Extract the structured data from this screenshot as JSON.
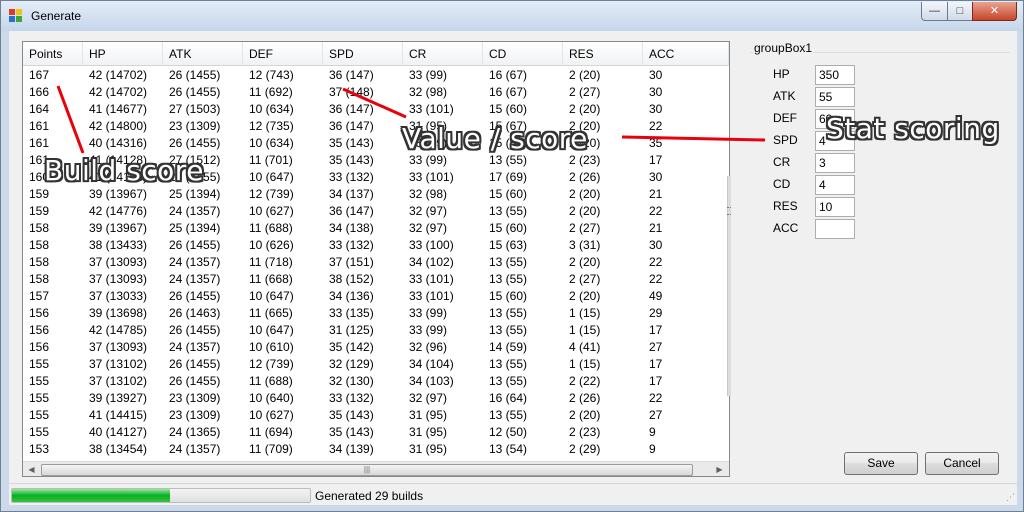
{
  "window": {
    "title": "Generate",
    "buttons": {
      "minimize": "—",
      "maximize": "□",
      "close": "✕"
    }
  },
  "table": {
    "columns": [
      "Points",
      "HP",
      "ATK",
      "DEF",
      "SPD",
      "CR",
      "CD",
      "RES",
      "ACC"
    ],
    "rows": [
      [
        "167",
        "42 (14702)",
        "26 (1455)",
        "12 (743)",
        "36 (147)",
        "33 (99)",
        "16 (67)",
        "2 (20)",
        "30"
      ],
      [
        "166",
        "42 (14702)",
        "26 (1455)",
        "11 (692)",
        "37 (148)",
        "32 (98)",
        "16 (67)",
        "2 (27)",
        "30"
      ],
      [
        "164",
        "41 (14677)",
        "27 (1503)",
        "10 (634)",
        "36 (147)",
        "33 (101)",
        "15 (60)",
        "2 (20)",
        "30"
      ],
      [
        "161",
        "42 (14800)",
        "23 (1309)",
        "12 (735)",
        "36 (147)",
        "31 (95)",
        "15 (67)",
        "2 (20)",
        "22"
      ],
      [
        "161",
        "40 (14316)",
        "26 (1455)",
        "10 (634)",
        "35 (143)",
        "33 (99)",
        "15 (60)",
        "2 (20)",
        "35"
      ],
      [
        "161",
        "41 (14128)",
        "27 (1512)",
        "11 (701)",
        "35 (143)",
        "33 (99)",
        "13 (55)",
        "2 (23)",
        "17"
      ],
      [
        "160",
        "41 (14128)",
        "26 (1455)",
        "10 (647)",
        "33 (132)",
        "33 (101)",
        "17 (69)",
        "2 (26)",
        "30"
      ],
      [
        "159",
        "39 (13967)",
        "25 (1394)",
        "12 (739)",
        "34 (137)",
        "32 (98)",
        "15 (60)",
        "2 (20)",
        "21"
      ],
      [
        "159",
        "42 (14776)",
        "24 (1357)",
        "10 (627)",
        "36 (147)",
        "32 (97)",
        "13 (55)",
        "2 (20)",
        "22"
      ],
      [
        "158",
        "39 (13967)",
        "25 (1394)",
        "11 (688)",
        "34 (138)",
        "32 (97)",
        "15 (60)",
        "2 (27)",
        "21"
      ],
      [
        "158",
        "38 (13433)",
        "26 (1455)",
        "10 (626)",
        "33 (132)",
        "33 (100)",
        "15 (63)",
        "3 (31)",
        "30"
      ],
      [
        "158",
        "37 (13093)",
        "24 (1357)",
        "11 (718)",
        "37 (151)",
        "34 (102)",
        "13 (55)",
        "2 (20)",
        "22"
      ],
      [
        "158",
        "37 (13093)",
        "24 (1357)",
        "11 (668)",
        "38 (152)",
        "33 (101)",
        "13 (55)",
        "2 (27)",
        "22"
      ],
      [
        "157",
        "37 (13033)",
        "26 (1455)",
        "10 (647)",
        "34 (136)",
        "33 (101)",
        "15 (60)",
        "2 (20)",
        "49"
      ],
      [
        "156",
        "39 (13698)",
        "26 (1463)",
        "11 (665)",
        "33 (135)",
        "33 (99)",
        "13 (55)",
        "1 (15)",
        "29"
      ],
      [
        "156",
        "42 (14785)",
        "26 (1455)",
        "10 (647)",
        "31 (125)",
        "33 (99)",
        "13 (55)",
        "1 (15)",
        "17"
      ],
      [
        "156",
        "37 (13093)",
        "24 (1357)",
        "10 (610)",
        "35 (142)",
        "32 (96)",
        "14 (59)",
        "4 (41)",
        "27"
      ],
      [
        "155",
        "37 (13102)",
        "26 (1455)",
        "12 (739)",
        "32 (129)",
        "34 (104)",
        "13 (55)",
        "1 (15)",
        "17"
      ],
      [
        "155",
        "37 (13102)",
        "26 (1455)",
        "11 (688)",
        "32 (130)",
        "34 (103)",
        "13 (55)",
        "2 (22)",
        "17"
      ],
      [
        "155",
        "39 (13927)",
        "23 (1309)",
        "10 (640)",
        "33 (132)",
        "32 (97)",
        "16 (64)",
        "2 (26)",
        "22"
      ],
      [
        "155",
        "41 (14415)",
        "23 (1309)",
        "10 (627)",
        "35 (143)",
        "31 (95)",
        "13 (55)",
        "2 (20)",
        "27"
      ],
      [
        "155",
        "40 (14127)",
        "24 (1365)",
        "11 (694)",
        "35 (143)",
        "31 (95)",
        "12 (50)",
        "2 (23)",
        "9"
      ],
      [
        "153",
        "38 (13454)",
        "24 (1357)",
        "11 (709)",
        "34 (139)",
        "31 (95)",
        "13 (54)",
        "2 (29)",
        "9"
      ]
    ],
    "scroll_thumb_glyph": "|||"
  },
  "groupbox": {
    "label": "groupBox1",
    "stats": [
      {
        "label": "HP",
        "value": "350"
      },
      {
        "label": "ATK",
        "value": "55"
      },
      {
        "label": "DEF",
        "value": "60"
      },
      {
        "label": "SPD",
        "value": "4"
      },
      {
        "label": "CR",
        "value": "3"
      },
      {
        "label": "CD",
        "value": "4"
      },
      {
        "label": "RES",
        "value": "10"
      },
      {
        "label": "ACC",
        "value": ""
      }
    ]
  },
  "buttons": {
    "save": "Save",
    "cancel": "Cancel"
  },
  "status": {
    "text": "Generated 29 builds",
    "progress_fraction": 0.53
  },
  "annotations": {
    "build_score": "Build score",
    "value_score": "Value / score",
    "stat_scoring": "Stat scoring",
    "color": "#e8000b"
  },
  "icon_colors": {
    "red": "#e03a1e",
    "yellow": "#f2c21b",
    "blue": "#2a6fd6",
    "green": "#3aa935"
  }
}
